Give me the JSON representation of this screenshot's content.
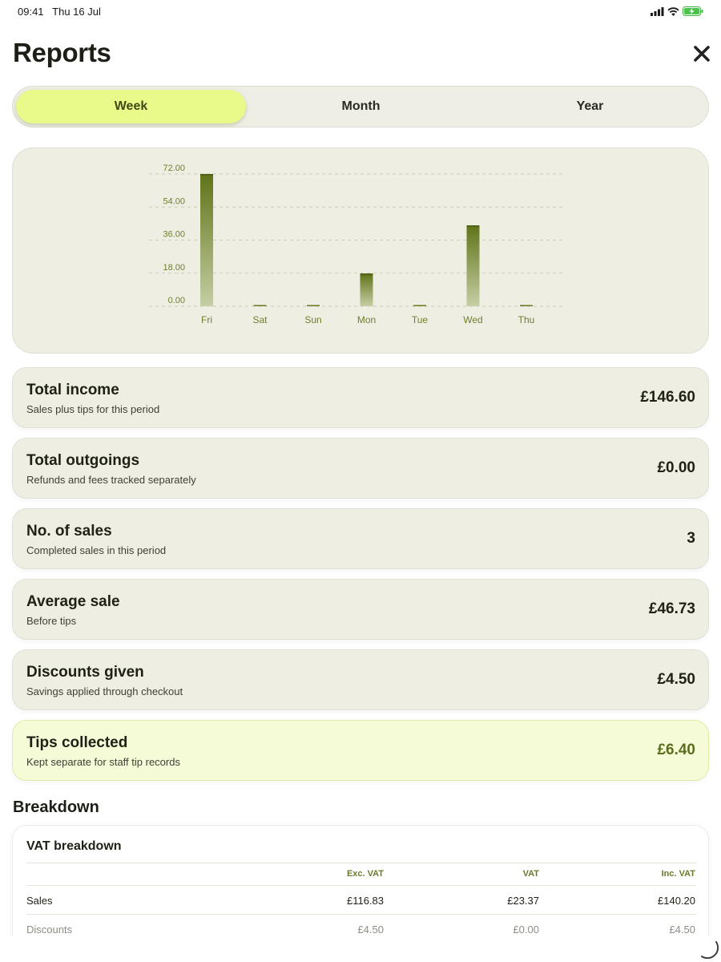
{
  "status_bar": {
    "time": "09:41",
    "date": "Thu 16 Jul",
    "icons": [
      "signal-icon",
      "wifi-icon",
      "battery-charging-icon"
    ]
  },
  "header": {
    "title": "Reports",
    "close_icon": "close-icon"
  },
  "period_tabs": [
    {
      "label": "Week",
      "active": true
    },
    {
      "label": "Month",
      "active": false
    },
    {
      "label": "Year",
      "active": false
    }
  ],
  "chart_data": {
    "type": "bar",
    "categories": [
      "Fri",
      "Sat",
      "Sun",
      "Mon",
      "Tue",
      "Wed",
      "Thu"
    ],
    "values": [
      72.0,
      0,
      0,
      17.8,
      0,
      44.0,
      0
    ],
    "y_ticks": [
      "0.00",
      "18.00",
      "36.00",
      "54.00",
      "72.00"
    ],
    "ylim": [
      0,
      72
    ],
    "grid": true,
    "bar_color": "#667b20"
  },
  "stats": [
    {
      "title": "Total income",
      "subtitle": "Sales plus tips for this period",
      "value": "£146.60"
    },
    {
      "title": "Total outgoings",
      "subtitle": "Refunds and fees tracked separately",
      "value": "£0.00"
    },
    {
      "title": "No. of sales",
      "subtitle": "Completed sales in this period",
      "value": "3"
    },
    {
      "title": "Average sale",
      "subtitle": "Before tips",
      "value": "£46.73"
    },
    {
      "title": "Discounts given",
      "subtitle": "Savings applied through checkout",
      "value": "£4.50"
    },
    {
      "title": "Tips collected",
      "subtitle": "Kept separate for staff tip records",
      "value": "£6.40",
      "highlight": true
    }
  ],
  "breakdown": {
    "title": "Breakdown",
    "vat": {
      "title": "VAT breakdown",
      "columns": [
        "Exc. VAT",
        "VAT",
        "Inc. VAT"
      ],
      "rows": [
        {
          "label": "Sales",
          "exc": "£116.83",
          "vat": "£23.37",
          "inc": "£140.20"
        },
        {
          "label": "Discounts",
          "exc": "£4.50",
          "vat": "£0.00",
          "inc": "£4.50"
        }
      ]
    }
  },
  "colors": {
    "accent": "#e9f98a",
    "brand": "#667b20",
    "card": "#eeeee3"
  }
}
